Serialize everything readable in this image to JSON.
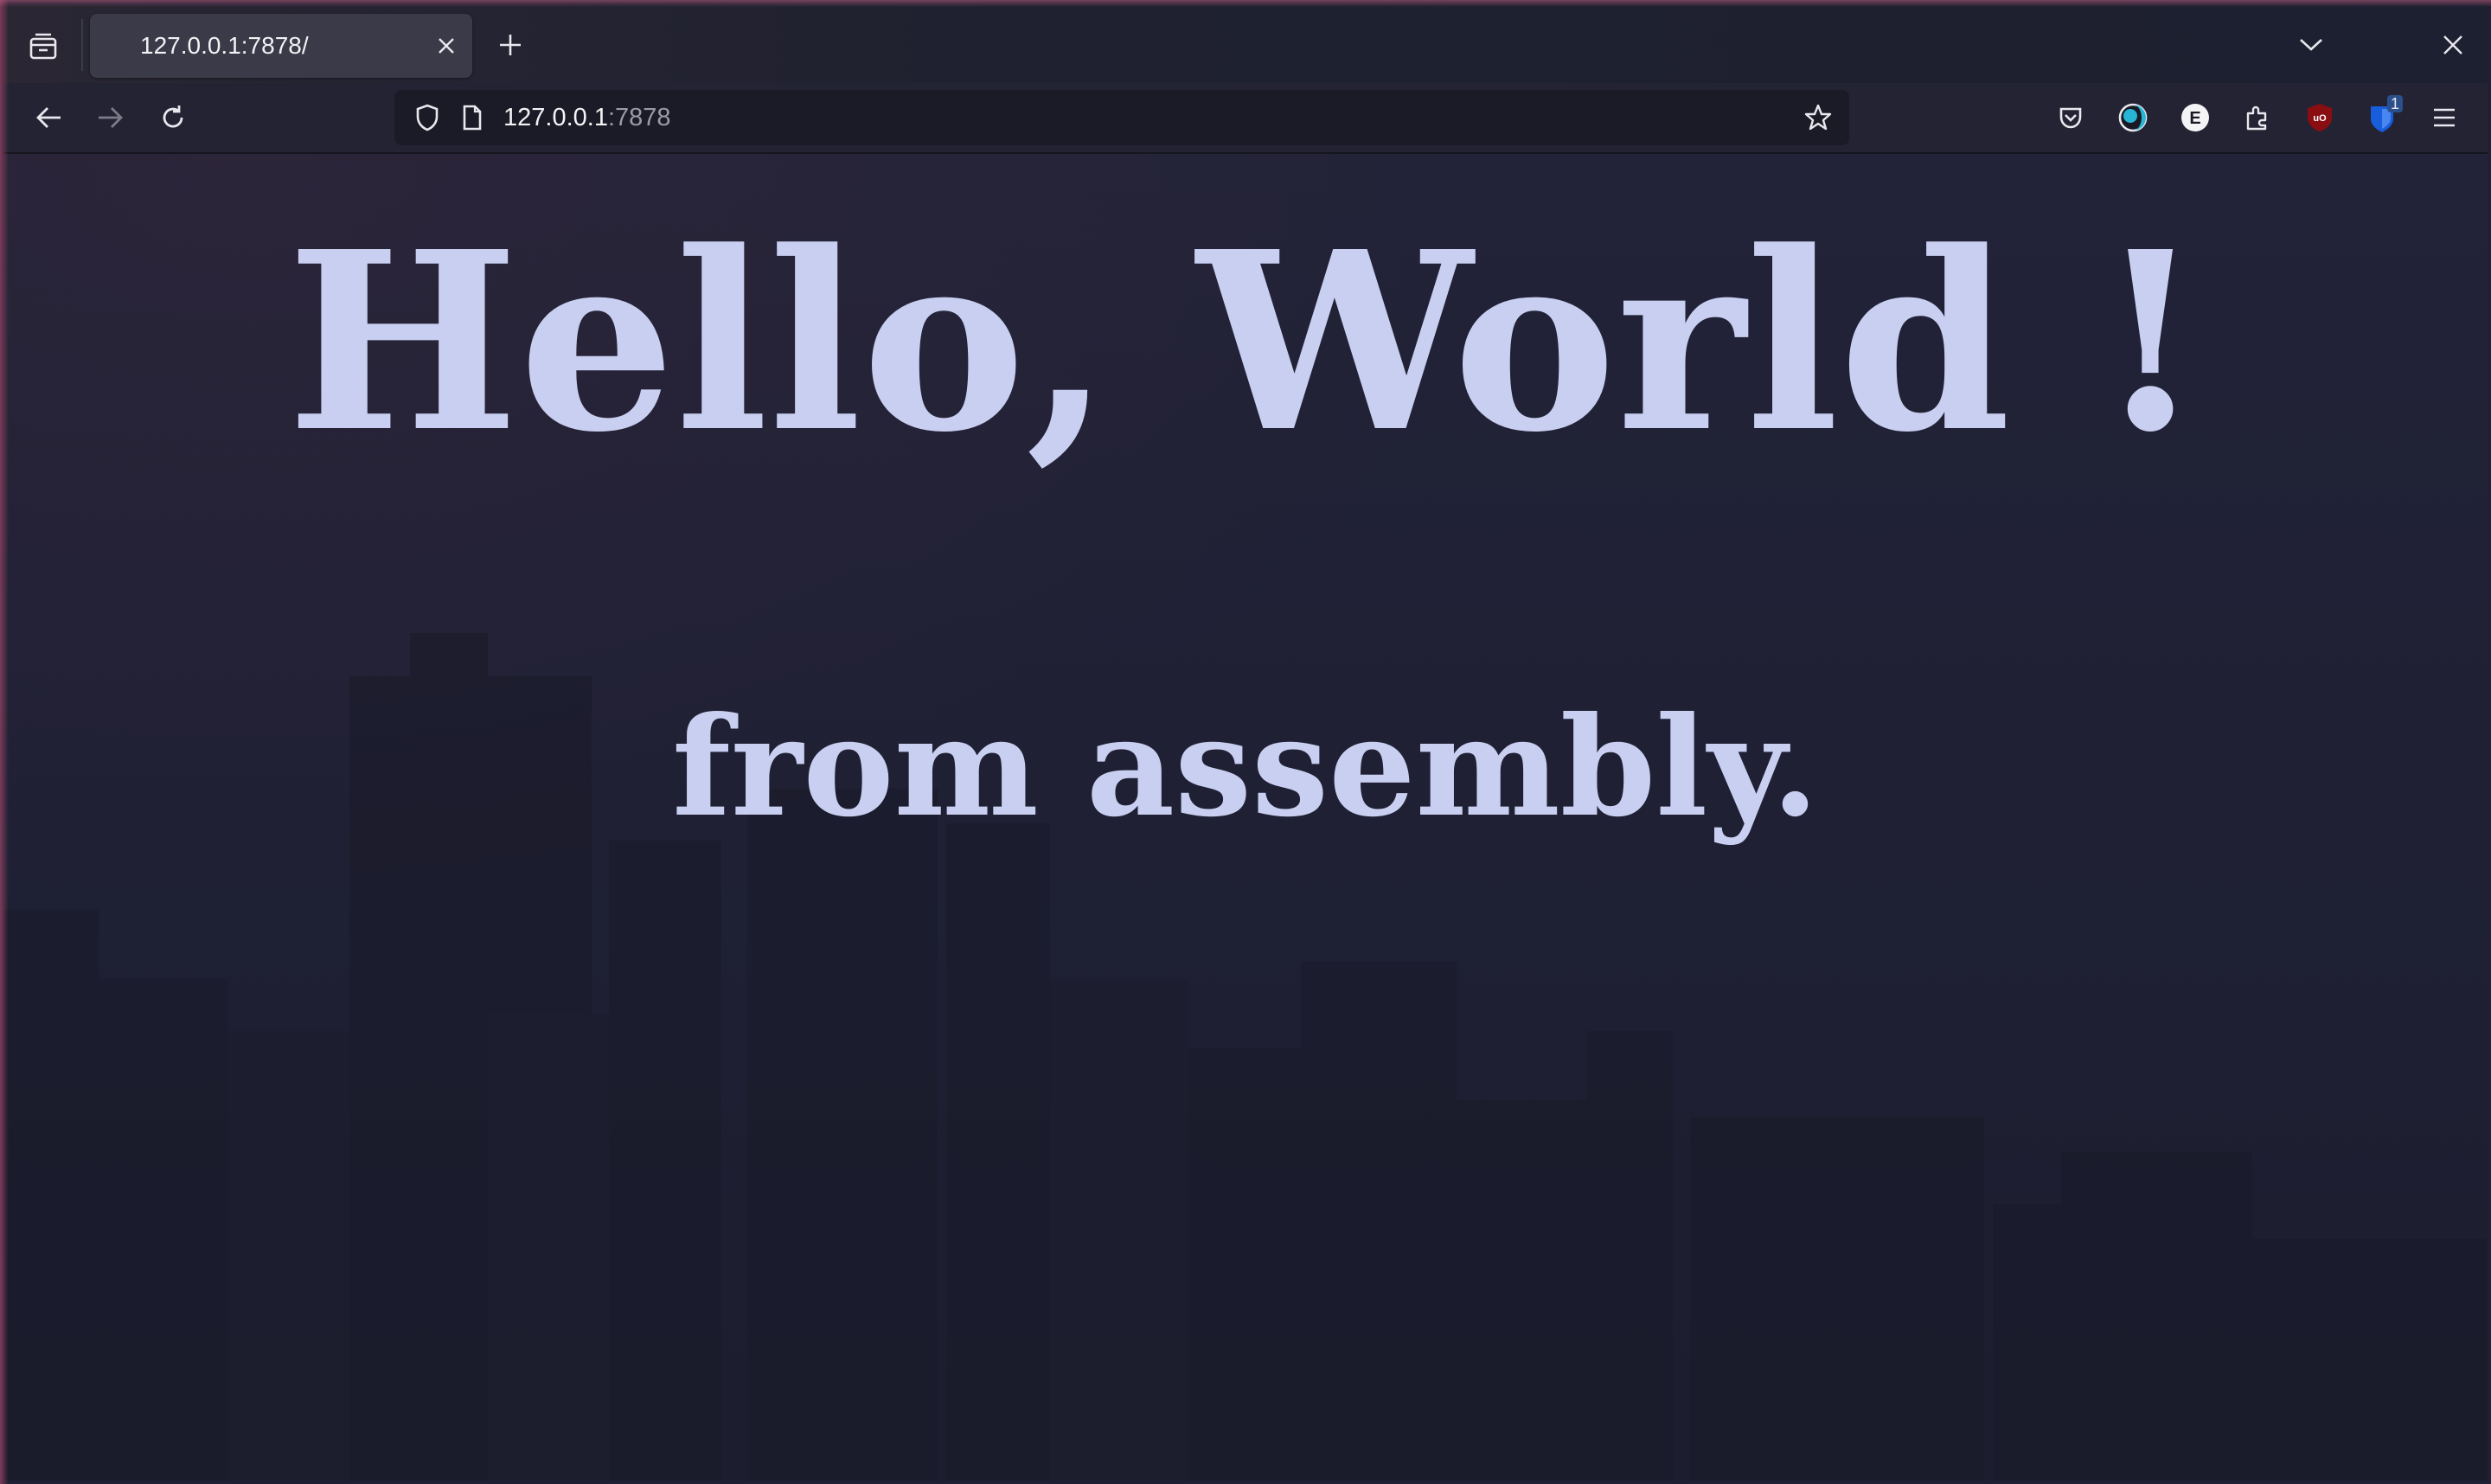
{
  "browser": {
    "tab": {
      "title": "127.0.0.1:7878/"
    },
    "urlbar": {
      "host": "127.0.0.1",
      "port_path": ":7878"
    },
    "extensions": [
      {
        "name": "pocket-icon"
      },
      {
        "name": "dark-reader-icon"
      },
      {
        "name": "extension-e-icon"
      },
      {
        "name": "extensions-puzzle-icon"
      },
      {
        "name": "ublock-origin-icon"
      },
      {
        "name": "bitwarden-icon",
        "badge": "1"
      }
    ]
  },
  "page": {
    "heading": "Hello, World !",
    "subheading": "from assembly."
  },
  "colors": {
    "page_text": "#c9cff0",
    "page_background": "#1f2034",
    "toolbar_background": "#232334",
    "tab_active": "#3a3a48"
  }
}
